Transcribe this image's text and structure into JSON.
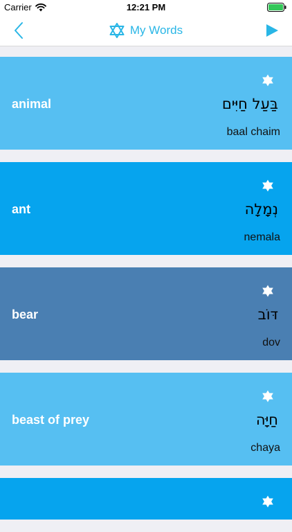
{
  "status_bar": {
    "carrier": "Carrier",
    "time": "12:21 PM"
  },
  "nav": {
    "title": "My Words",
    "back_icon": "chevron-left-icon",
    "play_icon": "play-icon",
    "title_icon": "star-of-david-icon"
  },
  "colors": {
    "accent": "#29b6e6",
    "card_light": "#56bff2",
    "card_bright": "#06a4ee",
    "card_dark": "#4a7fb2"
  },
  "words": [
    {
      "english": "animal",
      "hebrew": "בַּעַל חַיִּים",
      "translit": "baal chaim",
      "color": "#56bff2"
    },
    {
      "english": "ant",
      "hebrew": "נְמָלָה",
      "translit": "nemala",
      "color": "#06a4ee"
    },
    {
      "english": "bear",
      "hebrew": "דּוֹב",
      "translit": "dov",
      "color": "#4a7fb2"
    },
    {
      "english": "beast of prey",
      "hebrew": "חַיָּה",
      "translit": "chaya",
      "color": "#56bff2"
    },
    {
      "english": "",
      "hebrew": "",
      "translit": "",
      "color": "#06a4ee"
    }
  ]
}
